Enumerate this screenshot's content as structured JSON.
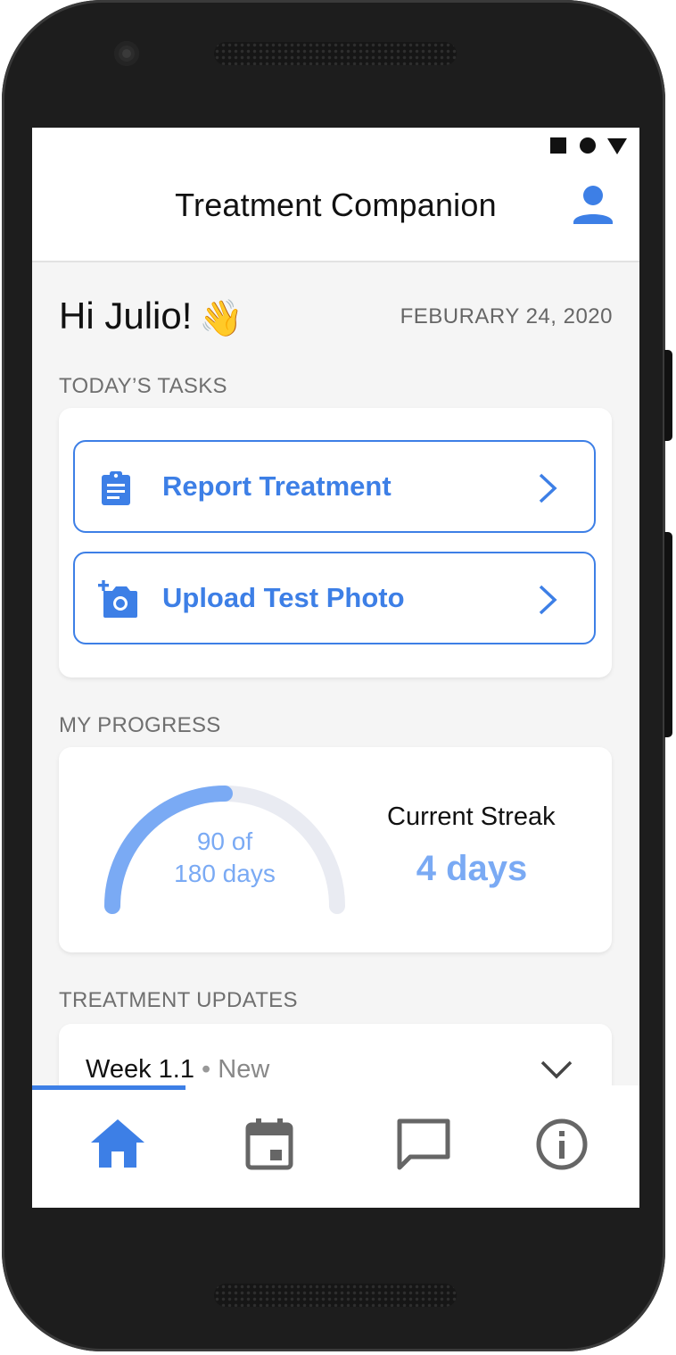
{
  "app": {
    "title": "Treatment Companion"
  },
  "greeting": {
    "text": "Hi Julio!",
    "emoji": "👋"
  },
  "date": "FEBURARY 24, 2020",
  "tasks": {
    "section_label": "TODAY’S TASKS",
    "items": [
      {
        "label": "Report Treatment",
        "icon": "clipboard-icon"
      },
      {
        "label": "Upload Test Photo",
        "icon": "add-photo-icon"
      }
    ]
  },
  "progress": {
    "section_label": "MY PROGRESS",
    "days_done": 90,
    "days_total": 180,
    "line1": "90 of",
    "line2": "180 days",
    "streak_label": "Current Streak",
    "streak_value": "4 days"
  },
  "updates": {
    "section_label": "TREATMENT UPDATES",
    "items": [
      {
        "title": "Week 1.1",
        "badge": "New"
      }
    ]
  },
  "nav": {
    "items": [
      {
        "name": "home",
        "icon": "home-icon",
        "active": true
      },
      {
        "name": "calendar",
        "icon": "calendar-icon",
        "active": false
      },
      {
        "name": "messages",
        "icon": "chat-icon",
        "active": false
      },
      {
        "name": "info",
        "icon": "info-icon",
        "active": false
      }
    ]
  },
  "colors": {
    "accent": "#3d7fe6",
    "accent_light": "#7aaaf4",
    "gauge_track": "#e9ebf2",
    "inactive_icon": "#666666"
  }
}
